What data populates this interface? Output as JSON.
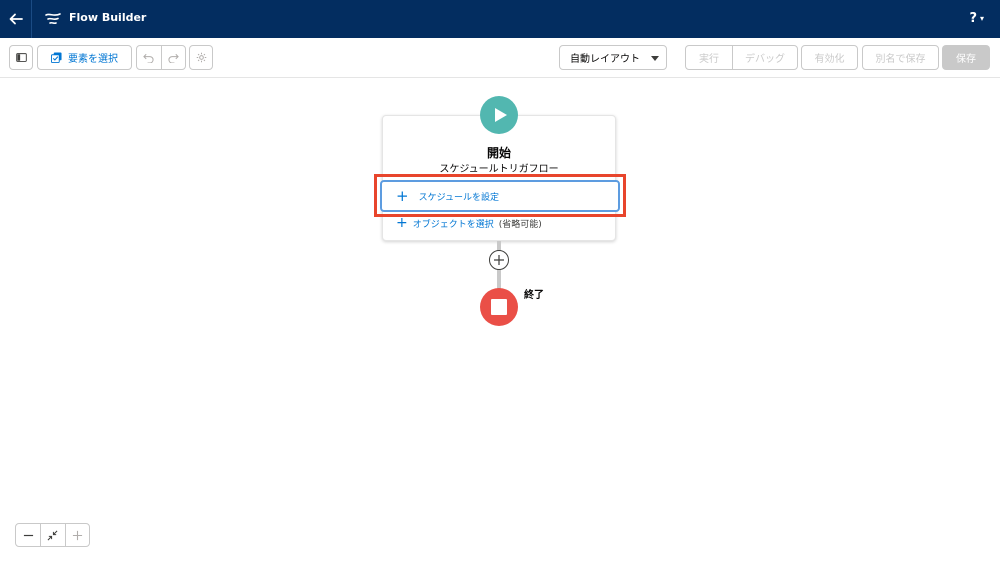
{
  "header": {
    "title": "Flow Builder",
    "help_label": "?",
    "help_caret": "▾",
    "back_icon": "arrow-left-icon",
    "logo_icon": "flow-icon",
    "background_color": "#032d60"
  },
  "toolbar": {
    "select_elements_label": "要素を選択",
    "layout_select_value": "自動レイアウト",
    "run_label": "実行",
    "debug_label": "デバッグ",
    "activate_label": "有効化",
    "save_as_label": "別名で保存",
    "save_label": "保存"
  },
  "canvas": {
    "start": {
      "title": "開始",
      "subtitle": "スケジュールトリガフロー",
      "icon_color": "#52b7b0"
    },
    "schedule_button_label": "スケジュールを設定",
    "object_link_label": "オブジェクトを選択",
    "object_link_optional": "(省略可能)",
    "end": {
      "label": "終了",
      "icon_color": "#ea4f47"
    },
    "highlight_color": "#e8452c"
  },
  "zoom": {
    "zoom_out_icon": "minus-icon",
    "fit_icon": "shrink-icon",
    "zoom_in_icon": "plus-icon"
  }
}
